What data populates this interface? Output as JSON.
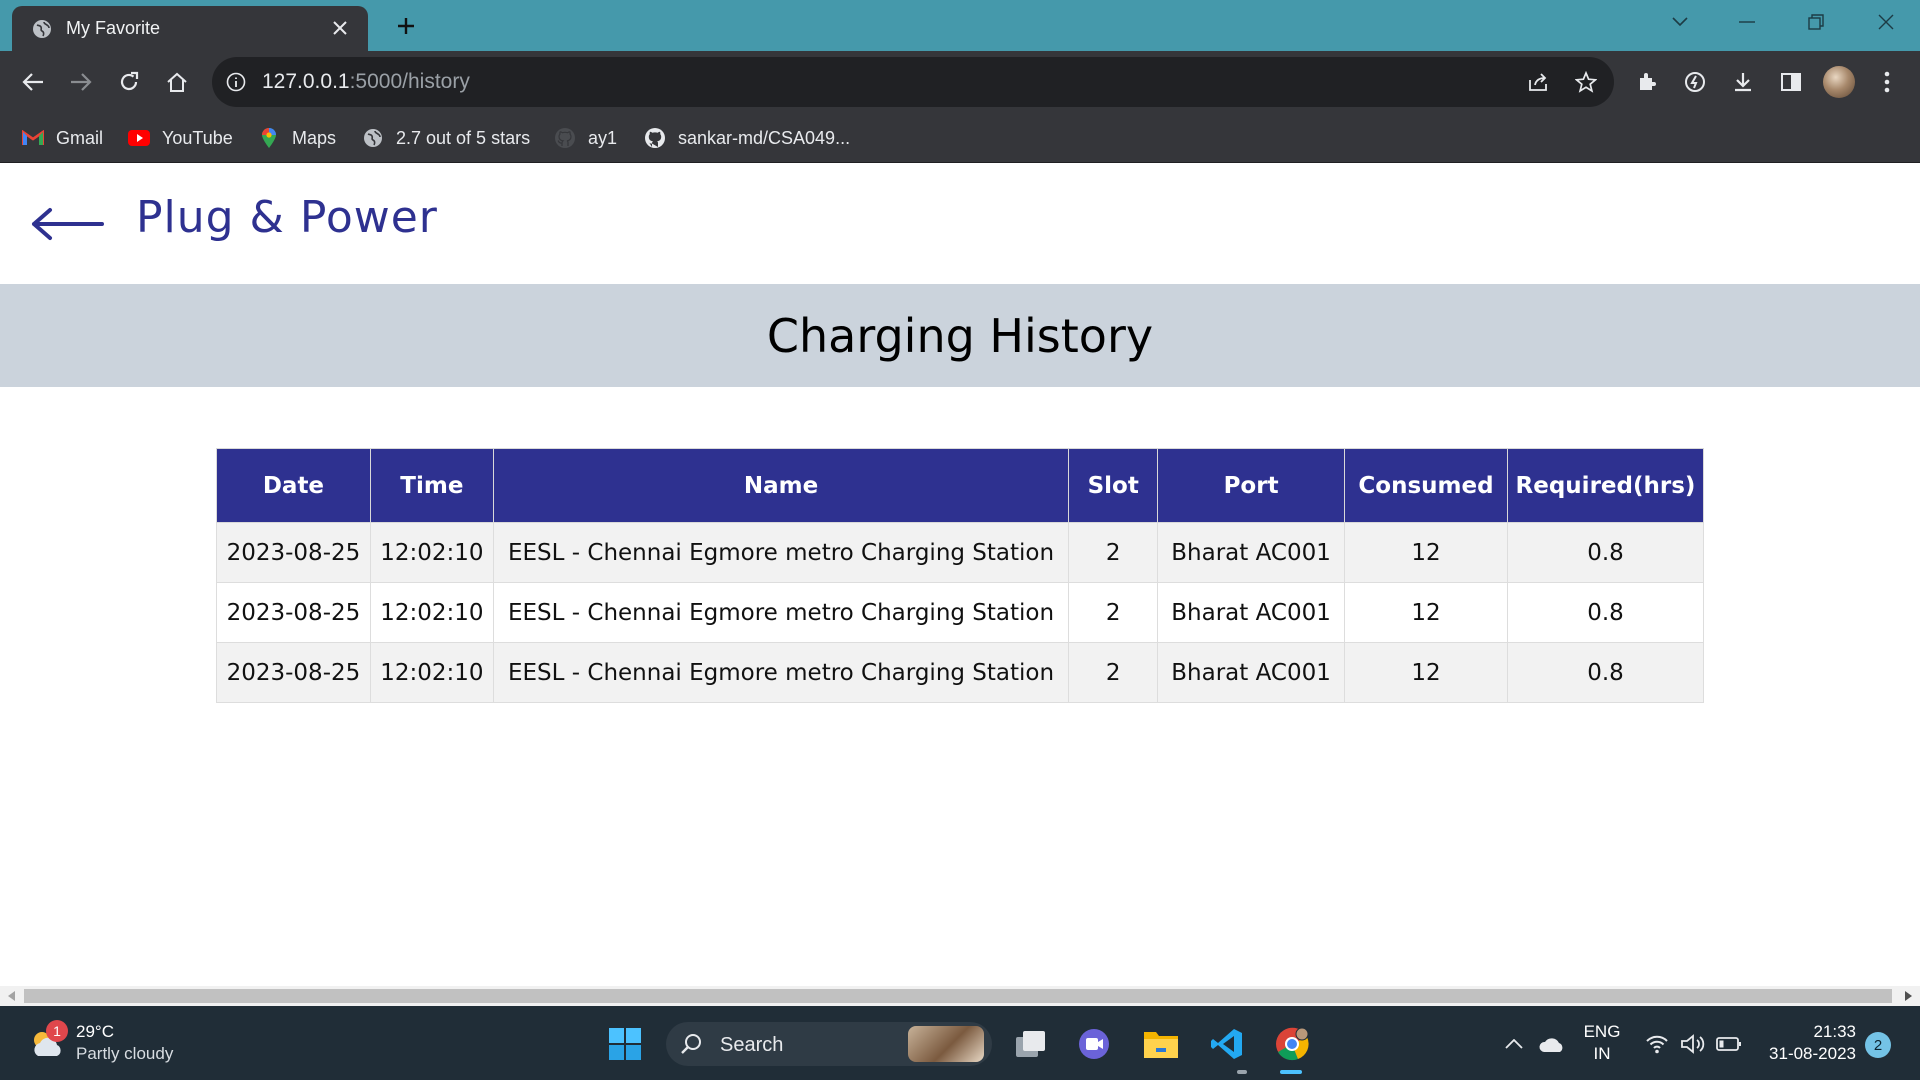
{
  "browser": {
    "tab_title": "My Favorite",
    "url_host": "127.0.0.1",
    "url_path": ":5000/history",
    "bookmarks": [
      {
        "label": "Gmail",
        "icon": "gmail-icon"
      },
      {
        "label": "YouTube",
        "icon": "youtube-icon"
      },
      {
        "label": "Maps",
        "icon": "maps-icon"
      },
      {
        "label": "2.7 out of 5 stars",
        "icon": "globe-icon"
      },
      {
        "label": "ay1",
        "icon": "github-icon"
      },
      {
        "label": "sankar-md/CSA049...",
        "icon": "github-icon"
      }
    ],
    "accent": "#4599ab"
  },
  "page": {
    "brand": "Plug & Power",
    "heading": "Charging History",
    "brand_color": "#2e3190",
    "banner_color": "#cbd3dc",
    "table": {
      "headers": [
        "Date",
        "Time",
        "Name",
        "Slot",
        "Port",
        "Consumed",
        "Required(hrs)"
      ],
      "rows": [
        [
          "2023-08-25",
          "12:02:10",
          "EESL - Chennai Egmore metro Charging Station",
          "2",
          "Bharat AC001",
          "12",
          "0.8"
        ],
        [
          "2023-08-25",
          "12:02:10",
          "EESL - Chennai Egmore metro Charging Station",
          "2",
          "Bharat AC001",
          "12",
          "0.8"
        ],
        [
          "2023-08-25",
          "12:02:10",
          "EESL - Chennai Egmore metro Charging Station",
          "2",
          "Bharat AC001",
          "12",
          "0.8"
        ]
      ]
    }
  },
  "taskbar": {
    "weather_temp": "29°C",
    "weather_cond": "Partly cloudy",
    "weather_badge": "1",
    "search_label": "Search",
    "lang_top": "ENG",
    "lang_bottom": "IN",
    "time": "21:33",
    "date": "31-08-2023",
    "notifications": "2"
  }
}
